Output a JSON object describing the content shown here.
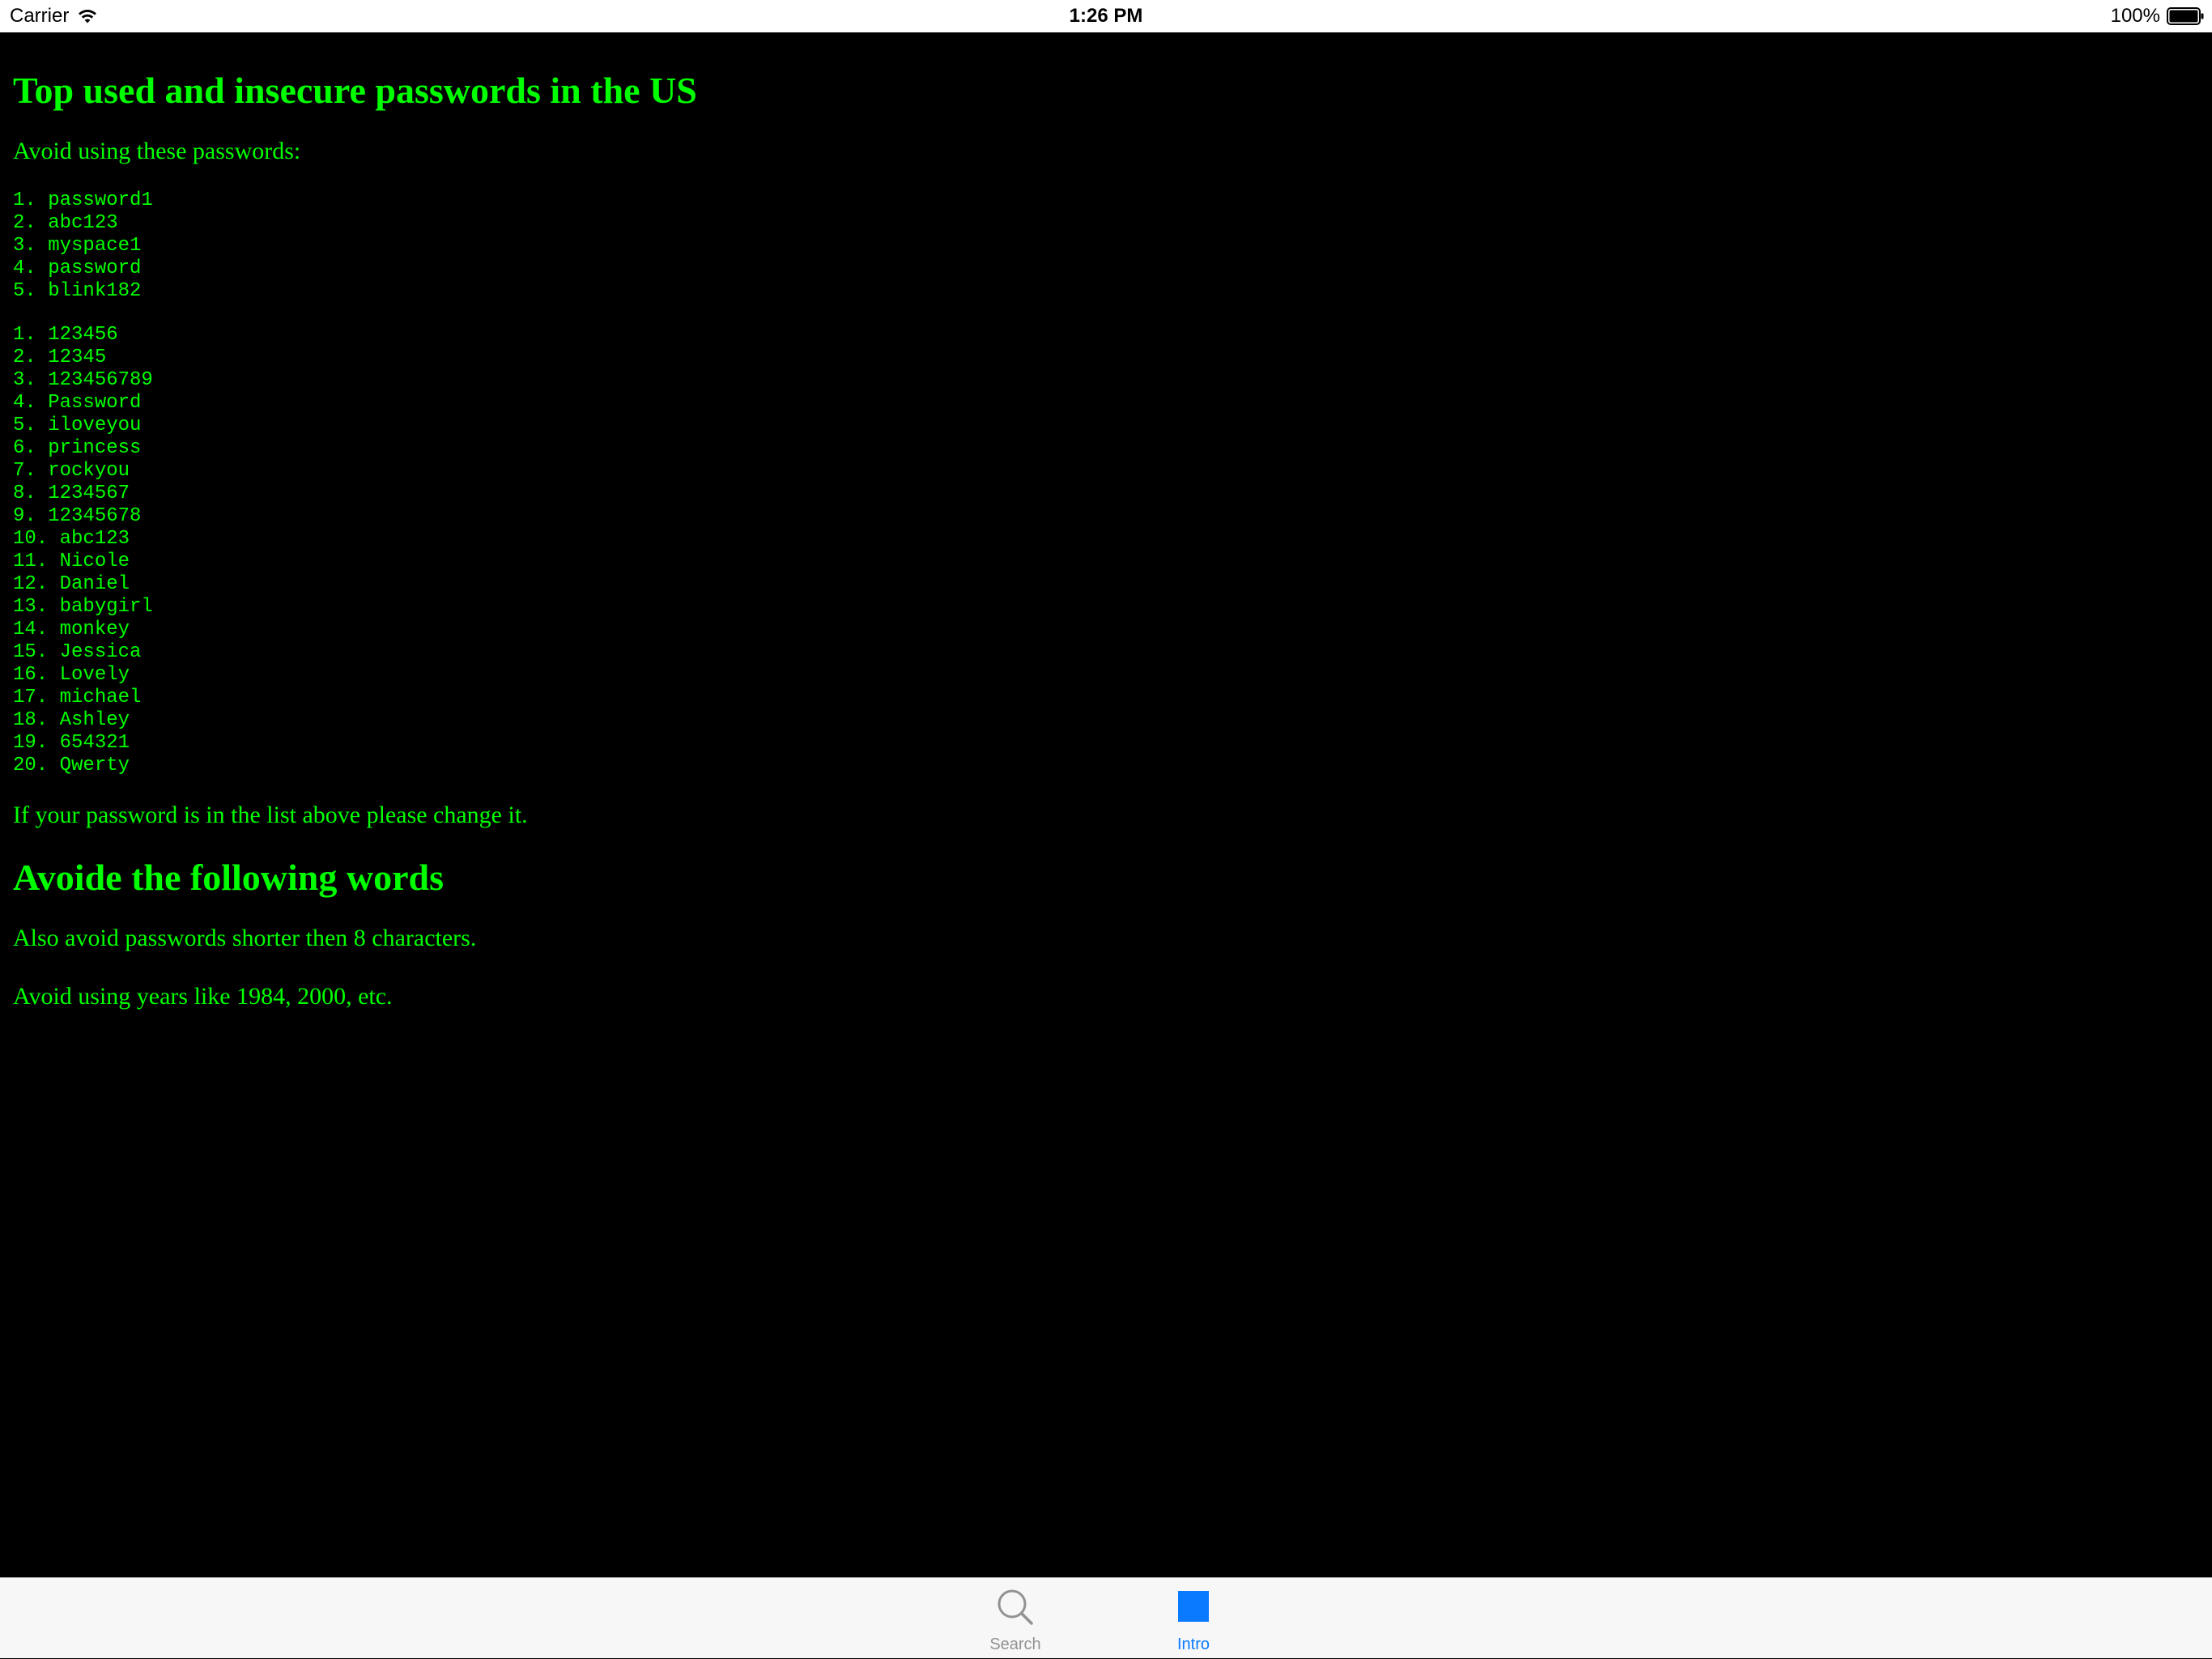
{
  "status_bar": {
    "carrier": "Carrier",
    "time": "1:26 PM",
    "battery": "100%",
    "wifi_icon": "wifi-icon",
    "battery_icon": "battery-full-icon"
  },
  "content": {
    "title": "Top used and insecure passwords in the US",
    "intro": "Avoid using these passwords:",
    "list_a": [
      "1. password1",
      "2. abc123",
      "3. myspace1",
      "4. password",
      "5. blink182"
    ],
    "list_b": [
      "1. 123456",
      "2. 12345",
      "3. 123456789",
      "4. Password",
      "5. iloveyou",
      "6. princess",
      "7. rockyou",
      "8. 1234567",
      "9. 12345678",
      "10. abc123",
      "11. Nicole",
      "12. Daniel",
      "13. babygirl",
      "14. monkey",
      "15. Jessica",
      "16. Lovely",
      "17. michael",
      "18. Ashley",
      "19. 654321",
      "20. Qwerty"
    ],
    "change_note": "If your password is in the list above please change it.",
    "heading2": "Avoide the following words",
    "short_note": "Also avoid passwords shorter then 8 characters.",
    "years_note": "Avoid using years like 1984, 2000, etc.",
    "text_color": "#00ff00",
    "background_color": "#000000"
  },
  "tab_bar": {
    "tabs": [
      {
        "label": "Search",
        "icon": "search-icon",
        "selected": false
      },
      {
        "label": "Intro",
        "icon": "square-icon",
        "selected": true
      }
    ],
    "selected_color": "#0a7aff",
    "unselected_color": "#929292"
  }
}
